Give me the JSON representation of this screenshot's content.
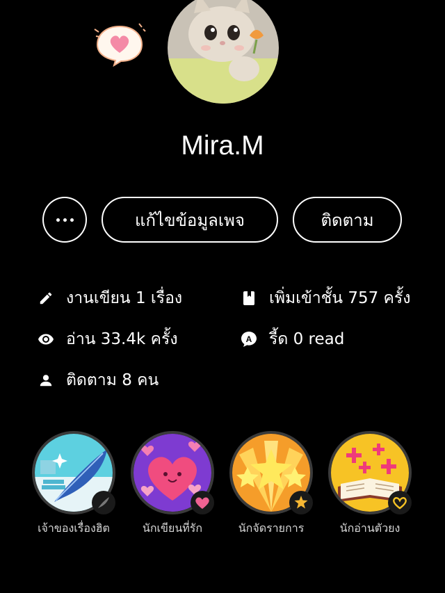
{
  "profile": {
    "name": "Mira.M"
  },
  "actions": {
    "edit_label": "แก้ไขข้อมูลเพจ",
    "follow_label": "ติดตาม"
  },
  "stats": {
    "works": "งานเขียน 1 เรื่อง",
    "reads": "อ่าน 33.4k ครั้ง",
    "followers": "ติดตาม 8 คน",
    "shelf": "เพิ่มเข้าชั้น 757 ครั้ง",
    "read_count": "รี้ด 0 read"
  },
  "badges": [
    {
      "label": "เจ้าของเรื่องฮิต",
      "icon": "quill-icon"
    },
    {
      "label": "นักเขียนที่รัก",
      "icon": "heart-icon"
    },
    {
      "label": "นักจัดรายการ",
      "icon": "star-icon"
    },
    {
      "label": "นักอ่านตัวยง",
      "icon": "open-book-icon"
    }
  ],
  "colors": {
    "background": "#000000",
    "text": "#ffffff",
    "badge_ring": "#3b3b3b",
    "heart_pink": "#f06292"
  }
}
